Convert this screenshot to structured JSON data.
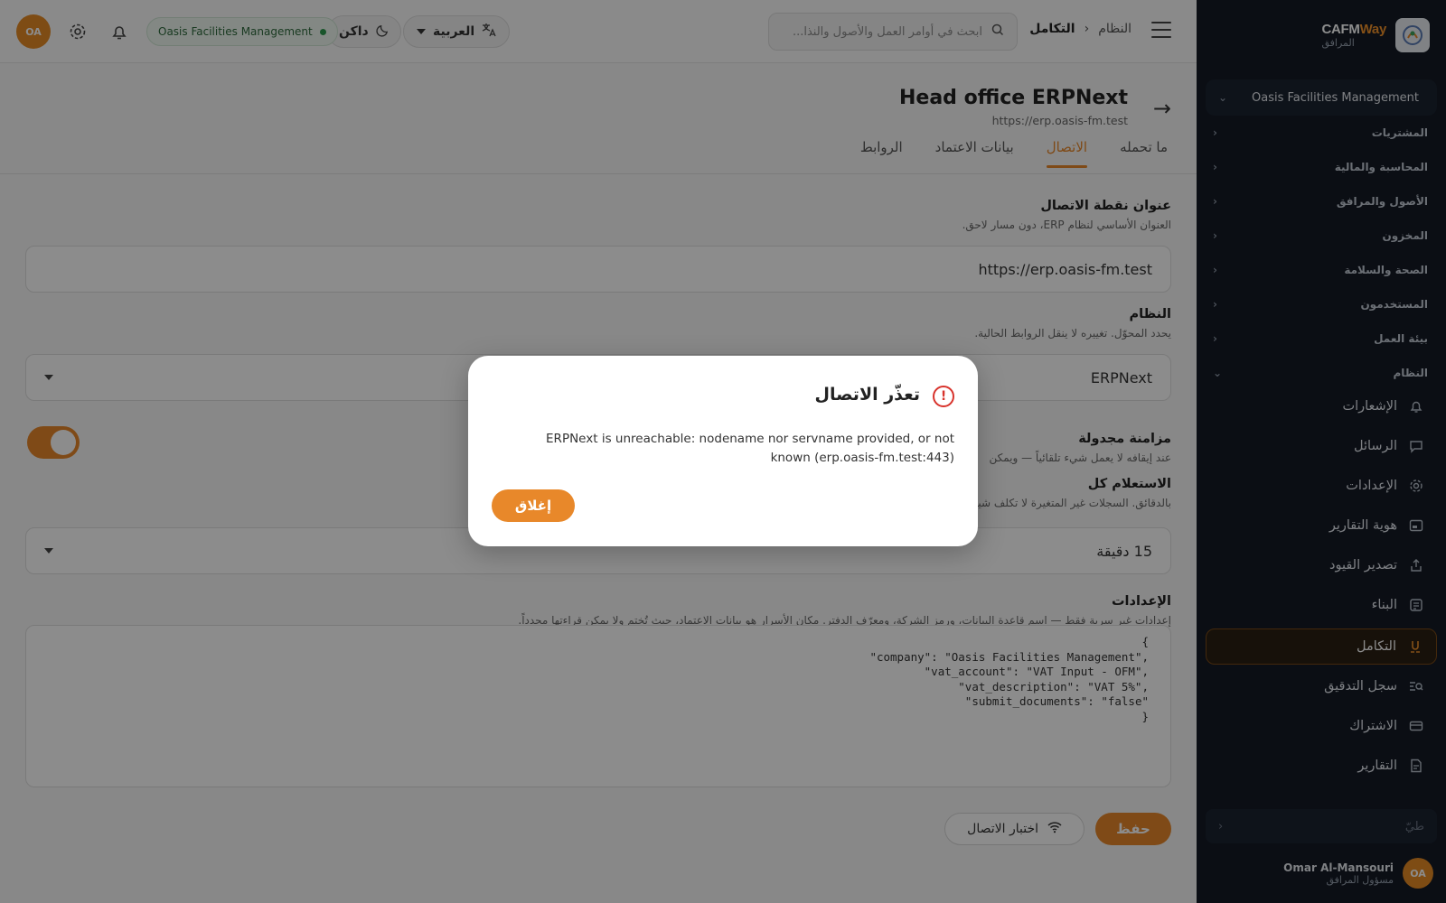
{
  "brand": {
    "name_main": "CAFM",
    "name_accent": "Way",
    "subtitle": "المرافق"
  },
  "sidebar": {
    "org_select": "Oasis Facilities Management",
    "sections": [
      {
        "label": "المشتريات"
      },
      {
        "label": "المحاسبة والمالية"
      },
      {
        "label": "الأصول والمرافق"
      },
      {
        "label": "المخزون"
      },
      {
        "label": "الصحة والسلامة"
      },
      {
        "label": "المستخدمون"
      },
      {
        "label": "بيئة العمل"
      },
      {
        "label": "النظام"
      }
    ],
    "items": [
      {
        "label": "الإشعارات",
        "icon": "bell-icon"
      },
      {
        "label": "الرسائل",
        "icon": "chat-icon"
      },
      {
        "label": "الإعدادات",
        "icon": "gear-icon"
      },
      {
        "label": "هوية التقارير",
        "icon": "report-identity-icon"
      },
      {
        "label": "تصدير القيود",
        "icon": "export-icon"
      },
      {
        "label": "البناء",
        "icon": "build-icon"
      },
      {
        "label": "التكامل",
        "icon": "integration-icon"
      },
      {
        "label": "سجل التدقيق",
        "icon": "audit-log-icon"
      },
      {
        "label": "الاشتراك",
        "icon": "credit-card-icon"
      },
      {
        "label": "التقارير",
        "icon": "reports-icon"
      }
    ],
    "search_placeholder": "طيّ",
    "user": {
      "initials": "OA",
      "name": "Omar Al-Mansouri",
      "role": "مسؤول المرافق"
    }
  },
  "topbar": {
    "breadcrumb_parent": "النظام",
    "breadcrumb_current": "التكامل",
    "search_placeholder": "ابحث في أوامر العمل والأصول والنذا...",
    "language": "العربية",
    "theme": "داكن",
    "org_pill": "Oasis Facilities Management",
    "avatar_initials": "OA"
  },
  "page": {
    "title": "Head office ERPNext",
    "url": "https://erp.oasis-fm.test",
    "tabs": [
      {
        "label": "ما تحمله"
      },
      {
        "label": "الاتصال"
      },
      {
        "label": "بيانات الاعتماد"
      },
      {
        "label": "الروابط"
      }
    ],
    "fields": {
      "endpoint_label": "عنوان نقطة الاتصال",
      "endpoint_help": "العنوان الأساسي لنظام ERP، دون مسار لاحق.",
      "endpoint_value": "https://erp.oasis-fm.test",
      "system_label": "النظام",
      "system_help": "يحدد المحوّل. تغييره لا ينقل الروابط الحالية.",
      "system_value": "ERPNext",
      "sync_label": "مزامنة مجدولة",
      "sync_help": "عند إيقافه لا يعمل شيء تلقائياً — ويمكن",
      "poll_label": "الاستعلام كل",
      "poll_help": "بالدقائق. السجلات غير المتغيرة لا تكلف شيئاً",
      "poll_value": "15 دقيقة",
      "settings_label": "الإعدادات",
      "settings_help": "إعدادات غير سرية فقط — اسم قاعدة البيانات، ورمز الشركة، ومعرّف الدفتر. مكان الأسرار هو بيانات الاعتماد، حيث تُختم ولا يمكن قراءتها مجدداً.",
      "settings_json": "{\n  \"company\": \"Oasis Facilities Management\",\n  \"vat_account\": \"VAT Input - OFM\",\n  \"vat_description\": \"VAT 5%\",\n  \"submit_documents\": \"false\"\n}"
    },
    "save_label": "حفظ",
    "test_label": "اختبار الاتصال"
  },
  "modal": {
    "title": "تعذّر الاتصال",
    "message": "ERPNext is unreachable: nodename nor servname provided, or not known (erp.oasis-fm.test:443)",
    "close_label": "إغلاق"
  },
  "colors": {
    "accent": "#e8882a",
    "sidebar_bg": "#141b26",
    "error": "#d8332c",
    "success": "#2e9b4f"
  }
}
